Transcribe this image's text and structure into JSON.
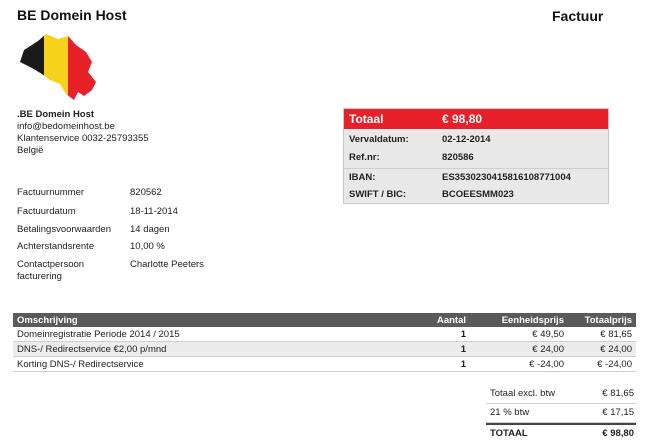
{
  "brand": "BE Domein Host",
  "doc_title": "Factuur",
  "company": {
    "name": ".BE Domein Host",
    "email": "info@bedomeinhost.be",
    "service": "Klantenservice  0032-25793355",
    "country": "België"
  },
  "meta": [
    {
      "label": "Factuurnummer",
      "value": "820562"
    },
    {
      "label": "Factuurdatum",
      "value": "18-11-2014"
    },
    {
      "label": "Betalingsvoorwaarden",
      "value": "14 dagen"
    },
    {
      "label": "Achterstandsrente",
      "value": "10,00 %"
    },
    {
      "label": "Contactpersoon facturering",
      "value": "Charlotte Peeters"
    }
  ],
  "summary": {
    "total_label": "Totaal",
    "total_value": "€ 98,80",
    "rows": [
      {
        "label": "Vervaldatum:",
        "value": "02-12-2014"
      },
      {
        "label": "Ref.nr:",
        "value": "820586"
      },
      {
        "label": "IBAN:",
        "value": "ES3530230415816108771004"
      },
      {
        "label": "SWIFT / BIC:",
        "value": "BCOEESMM023"
      }
    ]
  },
  "items": {
    "headers": {
      "description": "Omschrijving",
      "qty": "Aantal",
      "unit": "Eenheidsprijs",
      "total": "Totaalprijs"
    },
    "rows": [
      {
        "description": "Domeinregistratie Periode 2014 / 2015",
        "qty": "1",
        "unit": "€ 49,50",
        "total": "€ 81,65"
      },
      {
        "description": "DNS-/ Redirectservice €2,00 p/mnd",
        "qty": "1",
        "unit": "€ 24,00",
        "total": "€ 24,00"
      },
      {
        "description": "Korting DNS-/ Redirectservice",
        "qty": "1",
        "unit": "€ -24,00",
        "total": "€ -24,00"
      }
    ]
  },
  "totals": [
    {
      "label": "Totaal excl. btw",
      "value": "€ 81,65"
    },
    {
      "label": "21 % btw",
      "value": "€ 17,15"
    },
    {
      "label": "TOTAAL",
      "value": "€ 98,80"
    }
  ],
  "colors": {
    "accent": "#e8202a",
    "header": "#5a5a5a",
    "flag_black": "#1a1a1a",
    "flag_yellow": "#f6d21c",
    "flag_red": "#e8202a"
  }
}
